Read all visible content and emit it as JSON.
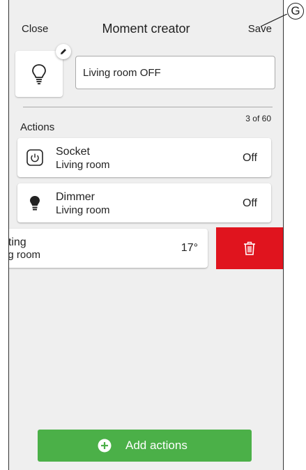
{
  "header": {
    "close_label": "Close",
    "title": "Moment creator",
    "save_label": "Save"
  },
  "moment": {
    "icon": "lightbulb-icon",
    "name_value": "Living room OFF"
  },
  "actions": {
    "label": "Actions",
    "count": "3 of 60",
    "items": [
      {
        "icon": "socket-power-icon",
        "name": "Socket",
        "room": "Living room",
        "state": "Off"
      },
      {
        "icon": "lightbulb-filled-icon",
        "name": "Dimmer",
        "room": "Living room",
        "state": "Off"
      },
      {
        "icon": "",
        "name": "ating",
        "room": "ng room",
        "state": "17°"
      }
    ],
    "delete_icon": "trash-icon",
    "delete_color": "#e0141e"
  },
  "add_button": {
    "label": "Add actions",
    "icon": "plus-circle-icon",
    "color": "#4bb048"
  },
  "annotation": {
    "callout_letter": "G"
  }
}
